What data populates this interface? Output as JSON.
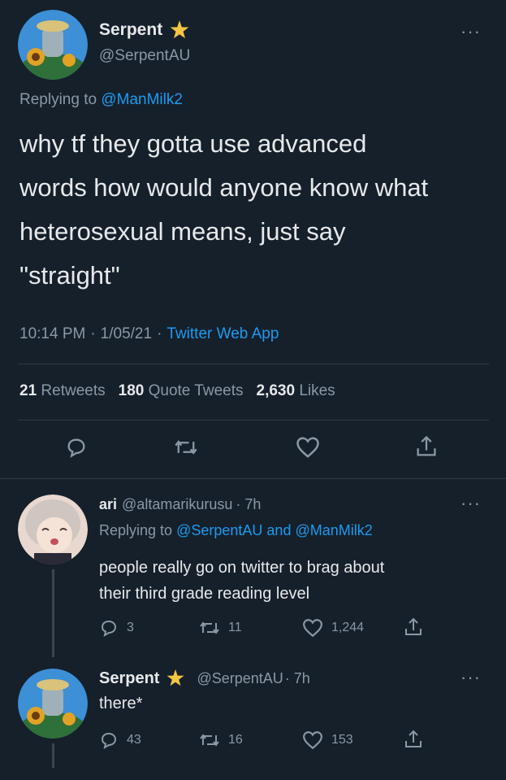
{
  "main_tweet": {
    "author_name": "Serpent",
    "author_handle": "@SerpentAU",
    "replying_prefix": "Replying to",
    "replying_to": "@ManMilk2",
    "text_lines": [
      "why tf they gotta use advanced",
      "words how would anyone know what",
      "heterosexual means, just say",
      "\"straight\""
    ],
    "time": "10:14 PM",
    "date": "1/05/21",
    "source": "Twitter Web App",
    "separator": "·",
    "retweets_count": "21",
    "retweets_label": "Retweets",
    "quotes_count": "180",
    "quotes_label": "Quote Tweets",
    "likes_count": "2,630",
    "likes_label": "Likes",
    "more": "···"
  },
  "reply_1": {
    "author_name": "ari",
    "author_handle": "@altamarikurusu",
    "time": "· 7h",
    "replying_prefix": "Replying to",
    "replying_to_1": "@SerpentAU",
    "and": "and",
    "replying_to_2": "@ManMilk2",
    "text_lines": [
      "people really go on twitter to brag about",
      "their third grade reading level"
    ],
    "replies": "3",
    "retweets": "11",
    "likes": "1,244",
    "more": "···"
  },
  "reply_2": {
    "author_name": "Serpent",
    "author_handle": "@SerpentAU",
    "time": "· 7h",
    "text": "there*",
    "replies": "43",
    "retweets": "16",
    "likes": "153",
    "more": "···"
  },
  "colors": {
    "background": "#15202b",
    "accent": "#1d9bf0",
    "badge": "#f4c542",
    "muted": "#8b98a5"
  },
  "icons": [
    "reply-icon",
    "retweet-icon",
    "like-icon",
    "share-icon",
    "star-badge-icon",
    "more-icon"
  ]
}
